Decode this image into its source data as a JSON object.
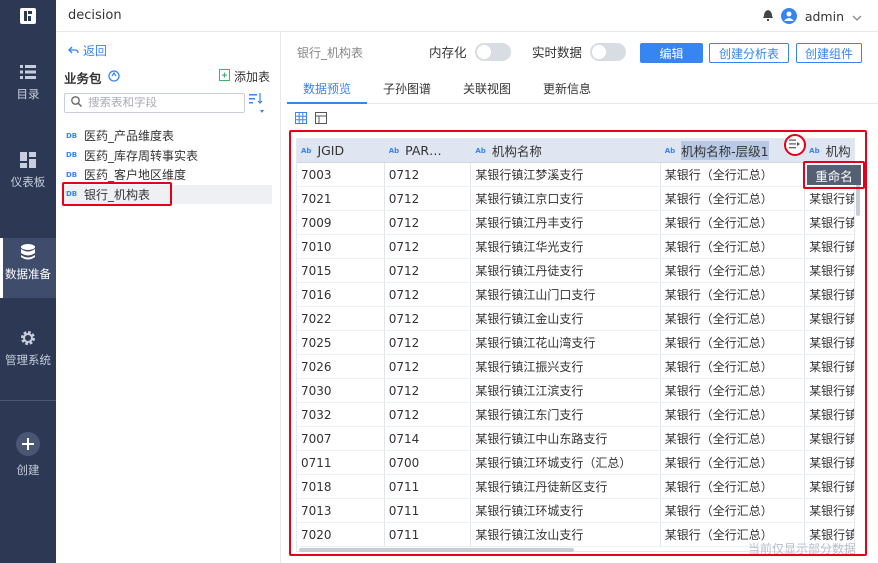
{
  "app": {
    "title": "decision",
    "user": "admin"
  },
  "nav": [
    {
      "label": "目录",
      "icon": "list-icon"
    },
    {
      "label": "仪表板",
      "icon": "dashboard-icon"
    },
    {
      "label": "数据准备",
      "icon": "database-icon",
      "active": true
    },
    {
      "label": "管理系统",
      "icon": "gear-icon"
    },
    {
      "label": "创建",
      "icon": "plus-icon"
    }
  ],
  "sidebar": {
    "back": "返回",
    "package": "业务包",
    "add_table": "添加表",
    "search_placeholder": "搜索表和字段",
    "tables": [
      "医药_产品维度表",
      "医药_库存周转事实表",
      "医药_客户地区维度",
      "银行_机构表"
    ],
    "selected_index": 3,
    "db_tag": "DB"
  },
  "main": {
    "table_name": "银行_机构表",
    "toggles": [
      {
        "label": "内存化",
        "on": false
      },
      {
        "label": "实时数据",
        "on": false
      }
    ],
    "buttons": {
      "edit": "编辑",
      "create_analysis": "创建分析表",
      "create_component": "创建组件"
    },
    "tabs": [
      "数据预览",
      "子孙图谱",
      "关联视图",
      "更新信息"
    ],
    "active_tab": 0,
    "field_tag": "Ab",
    "columns": [
      "JGID",
      "PAR…",
      "机构名称",
      "机构名称-层级1",
      "机构"
    ],
    "rows": [
      [
        "7003",
        "0712",
        "某银行镇江梦溪支行",
        "某银行（全行汇总）",
        "某银行镇"
      ],
      [
        "7021",
        "0712",
        "某银行镇江京口支行",
        "某银行（全行汇总）",
        "某银行镇"
      ],
      [
        "7009",
        "0712",
        "某银行镇江丹丰支行",
        "某银行（全行汇总）",
        "某银行镇"
      ],
      [
        "7010",
        "0712",
        "某银行镇江华光支行",
        "某银行（全行汇总）",
        "某银行镇"
      ],
      [
        "7015",
        "0712",
        "某银行镇江丹徒支行",
        "某银行（全行汇总）",
        "某银行镇"
      ],
      [
        "7016",
        "0712",
        "某银行镇江山门口支行",
        "某银行（全行汇总）",
        "某银行镇"
      ],
      [
        "7022",
        "0712",
        "某银行镇江金山支行",
        "某银行（全行汇总）",
        "某银行镇"
      ],
      [
        "7025",
        "0712",
        "某银行镇江花山湾支行",
        "某银行（全行汇总）",
        "某银行镇"
      ],
      [
        "7026",
        "0712",
        "某银行镇江振兴支行",
        "某银行（全行汇总）",
        "某银行镇"
      ],
      [
        "7030",
        "0712",
        "某银行镇江江滨支行",
        "某银行（全行汇总）",
        "某银行镇"
      ],
      [
        "7032",
        "0712",
        "某银行镇江东门支行",
        "某银行（全行汇总）",
        "某银行镇"
      ],
      [
        "7007",
        "0714",
        "某银行镇江中山东路支行",
        "某银行（全行汇总）",
        "某银行镇"
      ],
      [
        "0711",
        "0700",
        "某银行镇江环城支行（汇总）",
        "某银行（全行汇总）",
        "某银行镇"
      ],
      [
        "7018",
        "0711",
        "某银行镇江丹徒新区支行",
        "某银行（全行汇总）",
        "某银行镇"
      ],
      [
        "7013",
        "0711",
        "某银行镇江环城支行",
        "某银行（全行汇总）",
        "某银行镇"
      ],
      [
        "7020",
        "0711",
        "某银行镇江汝山支行",
        "某银行（全行汇总）",
        "某银行镇"
      ]
    ],
    "context_menu": "重命名",
    "note": "当前仅显示部分数据"
  }
}
